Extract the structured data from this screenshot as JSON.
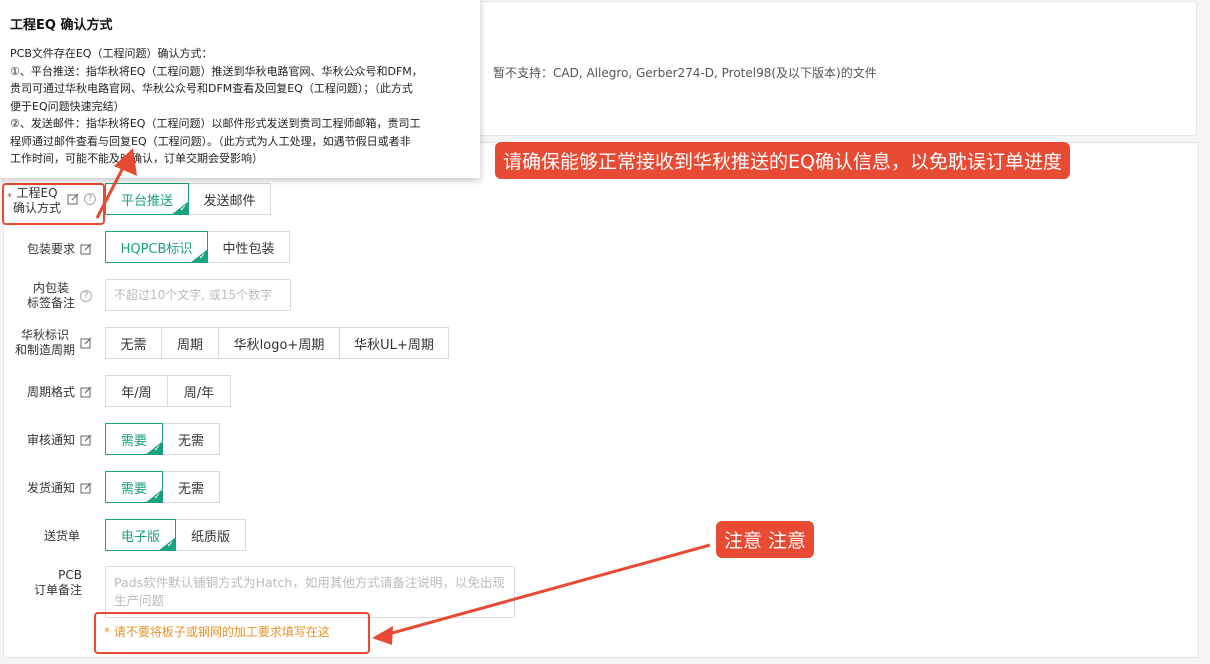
{
  "tooltip": {
    "title": "工程EQ 确认方式",
    "lines": [
      "PCB文件存在EQ（工程问题）确认方式：",
      "①、平台推送：指华秋将EQ（工程问题）推送到华秋电路官网、华秋公众号和DFM，",
      "贵司可通过华秋电路官网、华秋公众号和DFM查看及回复EQ（工程问题）；（此方式",
      "便于EQ问题快速完结）",
      "②、发送邮件：指华秋将EQ（工程问题）以邮件形式发送到贵司工程师邮箱，贵司工",
      "程师通过邮件查看与回复EQ（工程问题）。（此方式为人工处理，如遇节假日或者非",
      "工作时间，可能不能及时确认，订单交期会受影响）"
    ]
  },
  "unsupported_note": "暂不支持：CAD, Allegro, Gerber274-D, Protel98(及以下版本)的文件",
  "callouts": {
    "eq_notice": "请确保能够正常接收到华秋推送的EQ确认信息，以免耽误订单进度",
    "attention": "注意 注意"
  },
  "form": {
    "eq_confirm": {
      "label_line1": "工程EQ",
      "label_line2": "确认方式",
      "required_mark": "*",
      "options": [
        "平台推送",
        "发送邮件"
      ],
      "selected": "平台推送"
    },
    "packaging": {
      "label": "包装要求",
      "options": [
        "HQPCB标识",
        "中性包装"
      ],
      "selected": "HQPCB标识"
    },
    "inner_label": {
      "label_line1": "内包装",
      "label_line2": "标签备注",
      "placeholder": "不超过10个文字, 或15个数字"
    },
    "marking": {
      "label_line1": "华秋标识",
      "label_line2": "和制造周期",
      "options": [
        "无需",
        "周期",
        "华秋logo+周期",
        "华秋UL+周期"
      ],
      "selected": ""
    },
    "period_format": {
      "label": "周期格式",
      "options": [
        "年/周",
        "周/年"
      ],
      "selected": ""
    },
    "review_notice": {
      "label": "审核通知",
      "options": [
        "需要",
        "无需"
      ],
      "selected": "需要"
    },
    "ship_notice": {
      "label": "发货通知",
      "options": [
        "需要",
        "无需"
      ],
      "selected": "需要"
    },
    "delivery_note": {
      "label": "送货单",
      "options": [
        "电子版",
        "纸质版"
      ],
      "selected": "电子版"
    },
    "pcb_remark": {
      "label_line1": "PCB",
      "label_line2": "订单备注",
      "placeholder": "Pads软件默认铺铜方式为Hatch，如用其他方式请备注说明，以免出现生产问题"
    },
    "warning": "* 请不要将板子或钢网的加工要求填写在这"
  },
  "colors": {
    "accent": "#1aa182",
    "callout": "#e84a33",
    "warning": "#e6922a"
  }
}
